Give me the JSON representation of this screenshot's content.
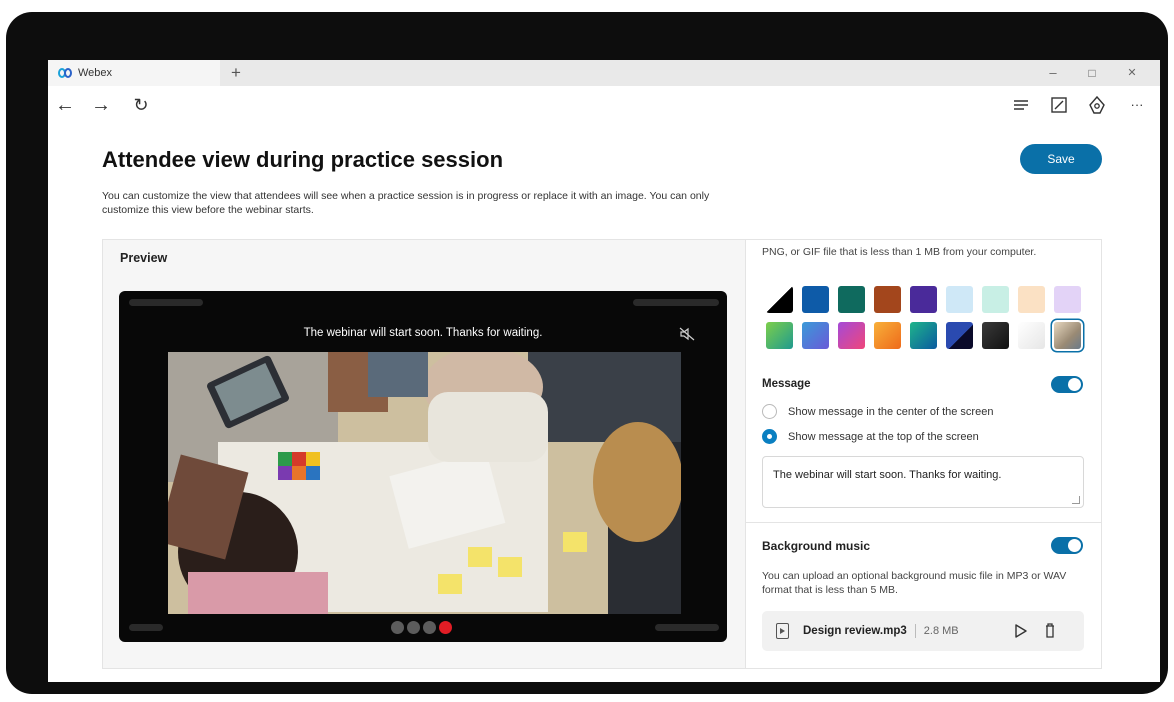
{
  "browser": {
    "tab_title": "Webex",
    "new_tab_label": "+",
    "window_controls": {
      "minimize": "–",
      "maximize": "□",
      "close": "✕"
    },
    "nav": {
      "back": "←",
      "forward": "→",
      "refresh": "↻",
      "more": "···"
    }
  },
  "page": {
    "title": "Attendee view during practice session",
    "description": "You can customize the view that attendees will see when a practice session is in progress or replace it with an image. You can only customize this view before the webinar starts.",
    "save_label": "Save"
  },
  "preview": {
    "heading": "Preview",
    "stage_message": "The webinar will start soon. Thanks for waiting.",
    "carousel": {
      "count": 4,
      "active_index": 3
    }
  },
  "background": {
    "description_fragment": "PNG, or GIF file that is less than 1 MB from your computer.",
    "swatches": [
      {
        "name": "black-white-split",
        "color": "#000000"
      },
      {
        "name": "blue",
        "color": "#0e5ba8"
      },
      {
        "name": "teal",
        "color": "#0f6a5e"
      },
      {
        "name": "rust",
        "color": "#a3461c"
      },
      {
        "name": "purple",
        "color": "#4a2a9a"
      },
      {
        "name": "light-blue",
        "color": "#cfe8f7"
      },
      {
        "name": "mint",
        "color": "#c8efe5"
      },
      {
        "name": "peach",
        "color": "#fbe1c4"
      },
      {
        "name": "lavender",
        "color": "#e3d3f7"
      },
      {
        "name": "gradient-green",
        "color": "#3db37a"
      },
      {
        "name": "gradient-blue",
        "color": "#4a7ad8"
      },
      {
        "name": "gradient-pink",
        "color": "#d9468a"
      },
      {
        "name": "gradient-orange",
        "color": "#f39a2a"
      },
      {
        "name": "gradient-teal",
        "color": "#1f9a7f"
      },
      {
        "name": "navy-split",
        "color": "#1a2a6a"
      },
      {
        "name": "charcoal",
        "color": "#2a2a2a"
      },
      {
        "name": "light-gray",
        "color": "#eeeeee"
      },
      {
        "name": "photo",
        "color": "#c9b8a0"
      }
    ],
    "selected_index": 17
  },
  "message": {
    "label": "Message",
    "enabled": true,
    "options": [
      {
        "label": "Show message in the center of the screen",
        "selected": false
      },
      {
        "label": "Show message at the top of the screen",
        "selected": true
      }
    ],
    "text_value": "The webinar will start soon. Thanks for waiting."
  },
  "music": {
    "label": "Background music",
    "enabled": true,
    "description": "You can upload an optional background music file in MP3 or WAV format that is less than 5 MB.",
    "file_name": "Design review.mp3",
    "file_size": "2.8 MB"
  },
  "colors": {
    "accent": "#0a70a8",
    "active_dot": "#e11d25"
  }
}
